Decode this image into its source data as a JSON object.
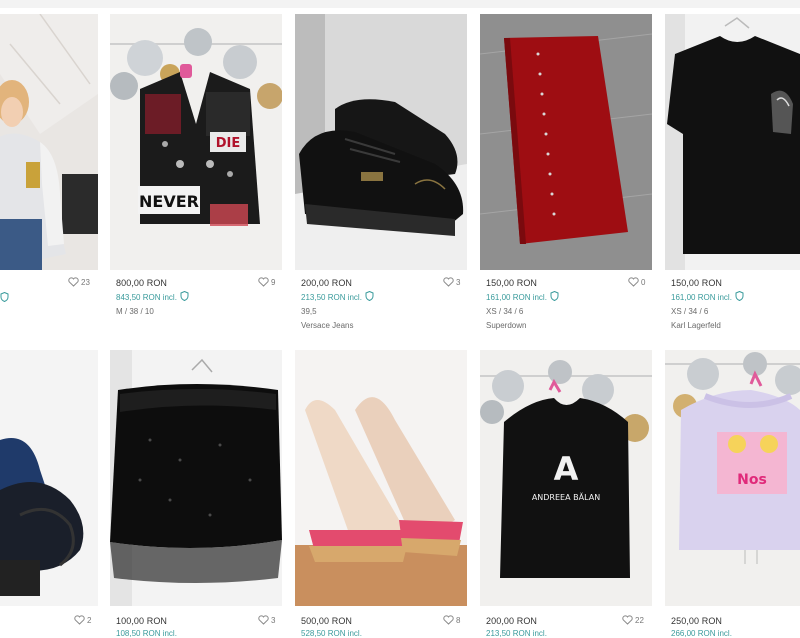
{
  "items": [
    {
      "id": "r1c1",
      "price": "",
      "incl": "",
      "size": "",
      "brand": "",
      "likes": "23"
    },
    {
      "id": "r1c2",
      "price": "800,00 RON",
      "incl": "843,50 RON incl.",
      "size": "M / 38 / 10",
      "brand": "",
      "likes": "9"
    },
    {
      "id": "r1c3",
      "price": "200,00 RON",
      "incl": "213,50 RON incl.",
      "size": "39,5",
      "brand": "Versace Jeans",
      "likes": "3"
    },
    {
      "id": "r1c4",
      "price": "150,00 RON",
      "incl": "161,00 RON incl.",
      "size": "XS / 34 / 6",
      "brand": "Superdown",
      "likes": "0"
    },
    {
      "id": "r1c5",
      "price": "150,00 RON",
      "incl": "161,00 RON incl.",
      "size": "XS / 34 / 6",
      "brand": "Karl Lagerfeld",
      "likes": ""
    },
    {
      "id": "r2c1",
      "price": "",
      "incl": "",
      "size": "",
      "brand": "",
      "likes": "2"
    },
    {
      "id": "r2c2",
      "price": "100,00 RON",
      "incl": "108,50 RON incl.",
      "size": "",
      "brand": "",
      "likes": "3"
    },
    {
      "id": "r2c3",
      "price": "500,00 RON",
      "incl": "528,50 RON incl.",
      "size": "",
      "brand": "",
      "likes": "8"
    },
    {
      "id": "r2c4",
      "price": "200,00 RON",
      "incl": "213,50 RON incl.",
      "size": "",
      "brand": "",
      "likes": "22"
    },
    {
      "id": "r2c5",
      "price": "250,00 RON",
      "incl": "266,00 RON incl.",
      "size": "",
      "brand": "",
      "likes": ""
    }
  ],
  "photos": {
    "r1c2_text": "NEVER",
    "r1c2_die": "DIE",
    "r2c4_brand": "ANDREEA BĂLAN",
    "r2c4_logo": "A",
    "r2c5_print": "Nos"
  },
  "colors": {
    "accent": "#3a9b9c",
    "heart": "#9a9a9a"
  }
}
